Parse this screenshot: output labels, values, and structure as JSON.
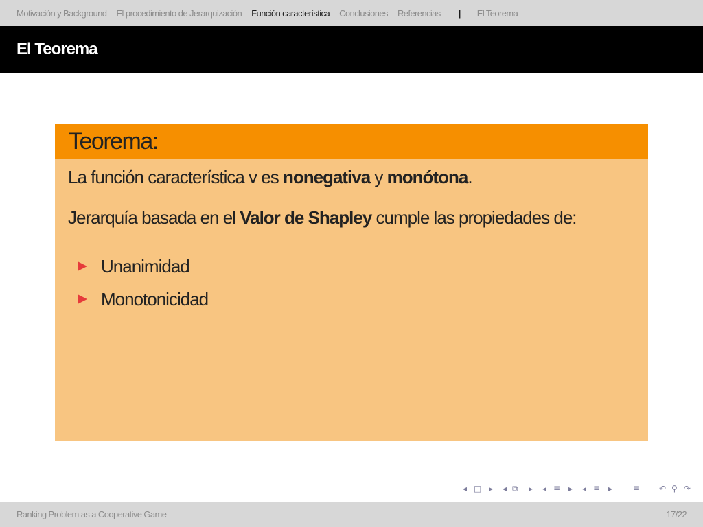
{
  "nav": {
    "sections": [
      {
        "label": "Motivación y Background",
        "active": false
      },
      {
        "label": "El procedimiento de Jerarquización",
        "active": false
      },
      {
        "label": "Función característica",
        "active": true
      },
      {
        "label": "Conclusiones",
        "active": false
      },
      {
        "label": "Referencias",
        "active": false
      }
    ],
    "separator": "|",
    "subsection": "El Teorema"
  },
  "frame": {
    "title": "El Teorema"
  },
  "theorem": {
    "heading": "Teorema:",
    "line1": {
      "pre": "La función característica v es ",
      "bold1": "nonegativa",
      "mid": " y ",
      "bold2": "monótona",
      "post": "."
    },
    "line2": {
      "pre": "Jerarquía basada en el ",
      "bold": "Valor de Shapley",
      "post": " cumple las propiedades de:"
    },
    "bullets": [
      "Unanimidad",
      "Monotonicidad"
    ]
  },
  "footer": {
    "left": "Ranking Problem as a Cooperative Game",
    "page": "17/22"
  },
  "colors": {
    "block_header": "#f68f00",
    "block_body": "#f8c581",
    "bullet": "#e63b3b"
  }
}
